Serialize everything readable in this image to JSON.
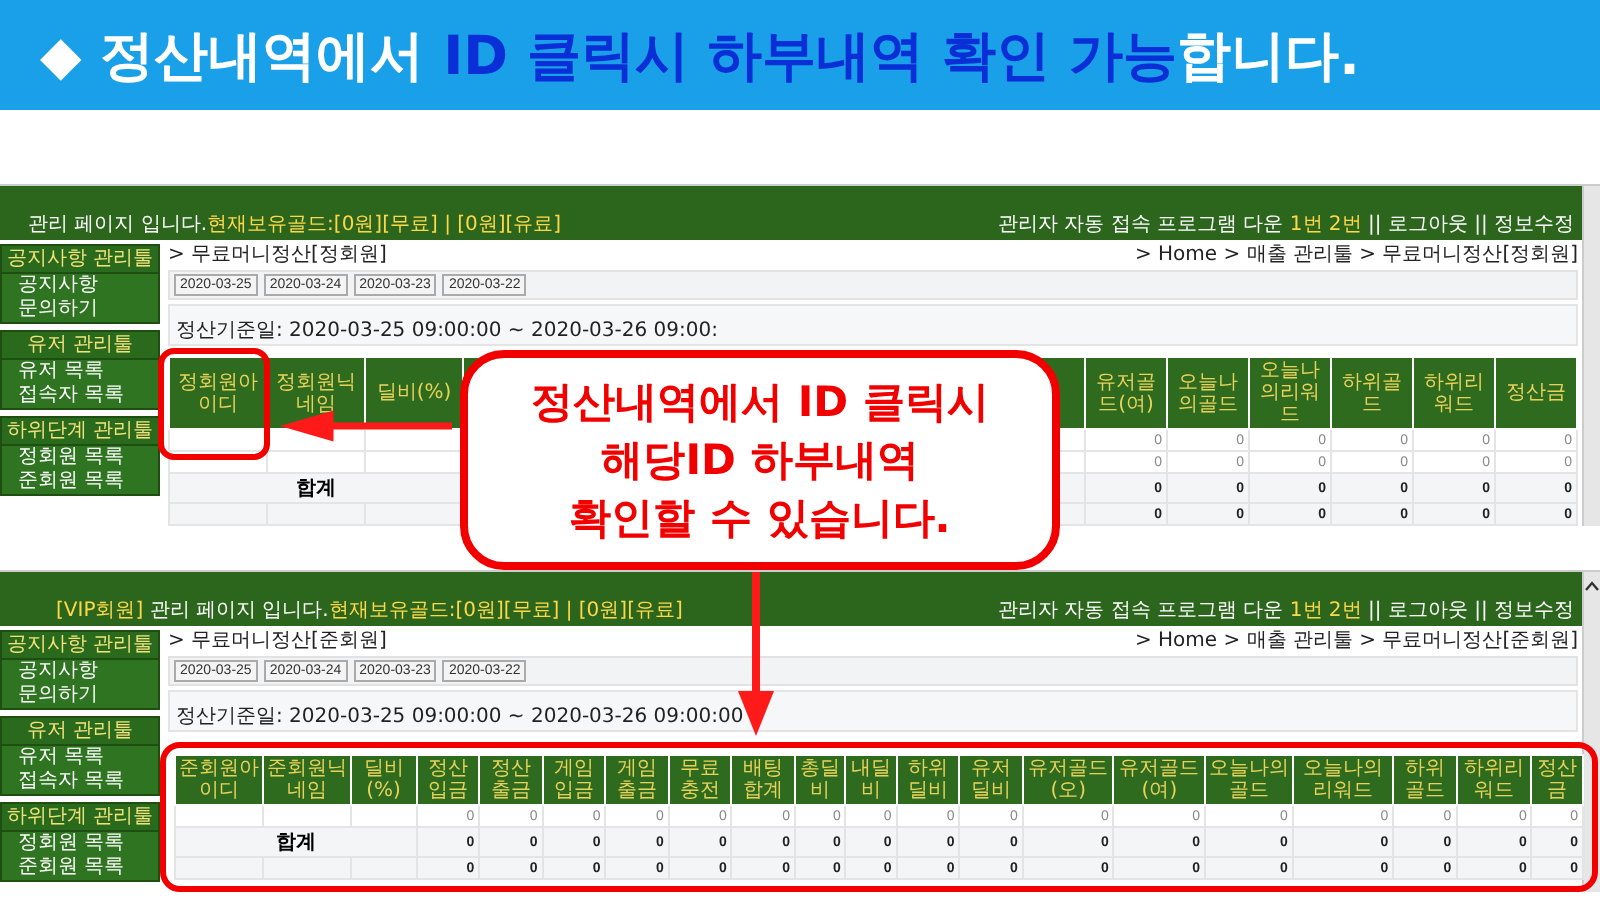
{
  "banner": {
    "icon": "◆",
    "segments": [
      {
        "text": "정산내역에서 ",
        "highlight": false
      },
      {
        "text": "ID 클릭시 하부내역 확인 가능",
        "highlight": true
      },
      {
        "text": "합니다.",
        "highlight": false
      }
    ]
  },
  "screens": [
    {
      "top_bar": {
        "left": [
          {
            "text": "관리 페이지 입니다.",
            "highlight": false
          },
          {
            "text": "현재보유골드:[0원][무료] | [0원][유료]",
            "highlight": true
          }
        ],
        "right": [
          {
            "text": "관리자 자동 접속 프로그램 다운 ",
            "highlight": false
          },
          {
            "text": "1번 2번",
            "highlight": true
          },
          {
            "text": " || 로그아웃 || 정보수정",
            "highlight": false
          }
        ]
      },
      "sidebar": [
        {
          "title": "공지사항 관리툴",
          "items": [
            "공지사항",
            "문의하기"
          ]
        },
        {
          "title": "유저 관리툴",
          "items": [
            "유저 목록",
            "접속자 목록"
          ]
        },
        {
          "title": "하위단계 관리툴",
          "items": [
            "정회원 목록",
            "준회원 목록"
          ]
        }
      ],
      "page_title": "> 무료머니정산[정회원]",
      "breadcrumb": "> Home > 매출 관리툴 > 무료머니정산[정회원]",
      "dates": [
        "2020-03-25",
        "2020-03-24",
        "2020-03-23",
        "2020-03-22"
      ],
      "period": "정산기준일: 2020-03-25 09:00:00 ~ 2020-03-26 09:00:",
      "table": {
        "lead_columns": [
          "정회원아이디",
          "정회원닉네임",
          "딜비(%)"
        ],
        "gap": true,
        "columns": [
          "유저골드(여)",
          "오늘나의골드",
          "오늘나의리워드",
          "하위골드",
          "하위리워드",
          "정산금"
        ],
        "rows": [
          {
            "kind": "data",
            "values": [
              "0",
              "0",
              "0",
              "0",
              "0",
              "0"
            ]
          },
          {
            "kind": "data",
            "values": [
              "0",
              "0",
              "0",
              "0",
              "0",
              "0"
            ]
          },
          {
            "kind": "total",
            "label": "합계",
            "values": [
              "0",
              "0",
              "0",
              "0",
              "0",
              "0"
            ]
          },
          {
            "kind": "total",
            "values": [
              "0",
              "0",
              "0",
              "0",
              "0",
              "0"
            ]
          }
        ]
      }
    },
    {
      "top_bar": {
        "left": [
          {
            "text": "[VIP회원]",
            "highlight": true
          },
          {
            "text": " 관리 페이지 입니다.",
            "highlight": false
          },
          {
            "text": "현재보유골드:[0원][무료] | [0원][유료]",
            "highlight": true
          }
        ],
        "right": [
          {
            "text": "관리자 자동 접속 프로그램 다운 ",
            "highlight": false
          },
          {
            "text": "1번 2번",
            "highlight": true
          },
          {
            "text": " || 로그아웃 || 정보수정",
            "highlight": false
          }
        ]
      },
      "sidebar": [
        {
          "title": "공지사항 관리툴",
          "items": [
            "공지사항",
            "문의하기"
          ]
        },
        {
          "title": "유저 관리툴",
          "items": [
            "유저 목록",
            "접속자 목록"
          ]
        },
        {
          "title": "하위단계 관리툴",
          "items": [
            "정회원 목록",
            "준회원 목록"
          ]
        }
      ],
      "page_title": "> 무료머니정산[준회원]",
      "breadcrumb": "> Home > 매출 관리툴 > 무료머니정산[준회원]",
      "dates": [
        "2020-03-25",
        "2020-03-24",
        "2020-03-23",
        "2020-03-22"
      ],
      "period": "정산기준일: 2020-03-25 09:00:00 ~ 2020-03-26 09:00:00",
      "table": {
        "lead_columns": [
          "준회원아이디",
          "준회원닉네임",
          "딜비(%)"
        ],
        "gap": false,
        "columns": [
          "정산입금",
          "정산출금",
          "게임입금",
          "게임출금",
          "무료충전",
          "배팅합계",
          "총딜비",
          "내딜비",
          "하위딜비",
          "유저딜비",
          "유저골드(오)",
          "유저골드(여)",
          "오늘나의골드",
          "오늘나의리워드",
          "하위골드",
          "하위리워드",
          "정산금"
        ],
        "rows": [
          {
            "kind": "data",
            "values": [
              "0",
              "0",
              "0",
              "0",
              "0",
              "0",
              "0",
              "0",
              "0",
              "0",
              "0",
              "0",
              "0",
              "0",
              "0",
              "0",
              "0"
            ]
          },
          {
            "kind": "total",
            "label": "합계",
            "values": [
              "0",
              "0",
              "0",
              "0",
              "0",
              "0",
              "0",
              "0",
              "0",
              "0",
              "0",
              "0",
              "0",
              "0",
              "0",
              "0",
              "0"
            ]
          },
          {
            "kind": "total",
            "values": [
              "0",
              "0",
              "0",
              "0",
              "0",
              "0",
              "0",
              "0",
              "0",
              "0",
              "0",
              "0",
              "0",
              "0",
              "0",
              "0",
              "0"
            ]
          }
        ]
      }
    }
  ],
  "callout": {
    "lines": [
      "정산내역에서 ID 클릭시",
      "해당ID 하부내역",
      "확인할 수 있습니다."
    ]
  }
}
